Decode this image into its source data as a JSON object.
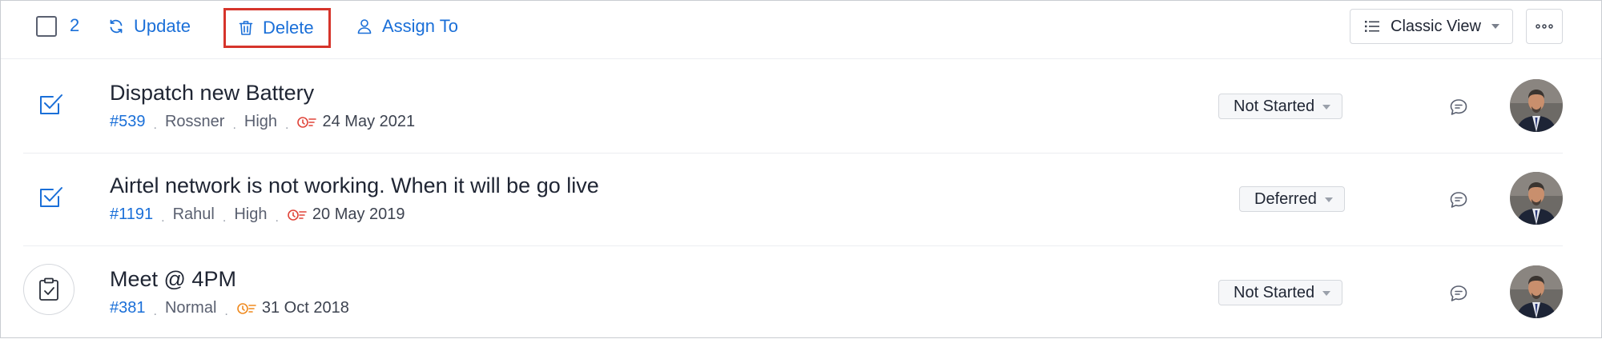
{
  "toolbar": {
    "selected_count": "2",
    "update_label": "Update",
    "delete_label": "Delete",
    "assign_label": "Assign To",
    "view_label": "Classic View"
  },
  "tasks": [
    {
      "title": "Dispatch new Battery",
      "id": "#539",
      "owner": "Rossner",
      "priority": "High",
      "due_date": "24 May 2021",
      "status": "Not Started",
      "icon": "checkbox-task-icon"
    },
    {
      "title": "Airtel network is not working. When it will be go live",
      "id": "#1191",
      "owner": "Rahul",
      "priority": "High",
      "due_date": "20 May 2019",
      "status": "Deferred",
      "icon": "checkbox-task-icon"
    },
    {
      "title": "Meet @ 4PM",
      "id": "#381",
      "owner": "",
      "priority": "Normal",
      "due_date": "31 Oct 2018",
      "status": "Not Started",
      "icon": "clipboard-check-icon"
    }
  ],
  "colors": {
    "accent": "#1a6fd8",
    "highlight_border": "#d6342b",
    "overdue": "#e0453a",
    "due_orange": "#ef8a1f"
  }
}
